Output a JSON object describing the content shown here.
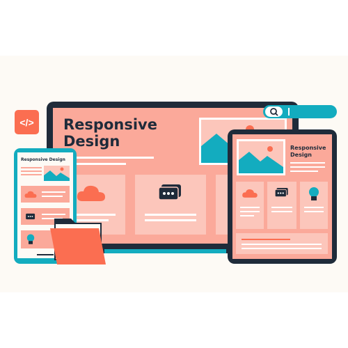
{
  "colors": {
    "navy": "#1f2b3a",
    "salmon": "#fba99a",
    "salmon_light": "#fcc6bb",
    "teal": "#13acbf",
    "coral": "#fb6e51",
    "background": "#fdfaf5"
  },
  "code_badge": {
    "glyph": "</>",
    "icon": "code-icon"
  },
  "laptop": {
    "title_line1": "Responsive",
    "title_line2": "Design"
  },
  "phone": {
    "title": "Responsive Design"
  },
  "tablet": {
    "title_line1": "Responsive",
    "title_line2": "Design"
  },
  "icons": [
    "cloud-icon",
    "chat-icon",
    "lightbulb-icon",
    "image-icon",
    "search-icon",
    "folder-icon"
  ]
}
